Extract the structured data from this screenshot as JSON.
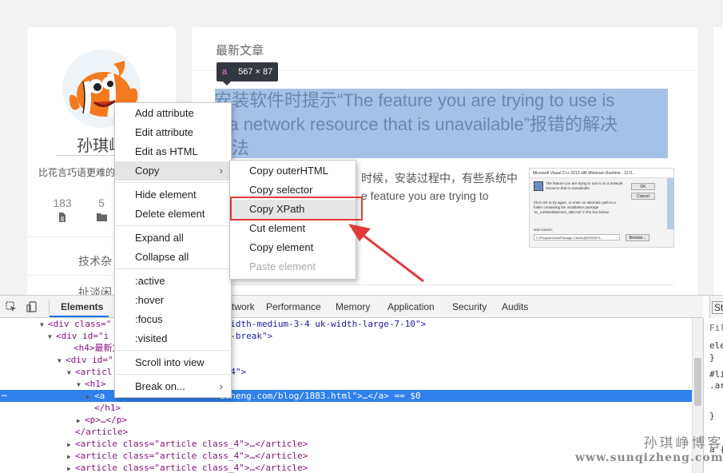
{
  "profile": {
    "name": "孙琪峥",
    "name_visible": "孙琪屾",
    "motto": "比花言巧语更难的",
    "stats": [
      {
        "value": "183",
        "icon": "document-icon"
      },
      {
        "value": "5",
        "icon": "folder-icon"
      }
    ],
    "link1": "技术杂",
    "link2": "扯淡闲"
  },
  "main": {
    "section_title": "最新文章",
    "article_title": "安装软件时提示“The feature you are trying to use is on a network resource that is unavailable”报错的解决办法",
    "article_title_visible": "安装软件时提示“The feature you are trying to use is\nn a network resource that is unavailable”报错的解决\n方法",
    "excerpt_line1": "时候，安装过程中，有些系统中",
    "excerpt_line2": "e feature you are trying to",
    "thumb": {
      "window_title": "Microsoft Visual C++ 2013 x86 Minimum Runtime - 12.0...",
      "message": "The feature you are trying to use is on a network resource that is unavailable.",
      "hint": "Click OK to try again, or enter an alternate path to a folder containing the installation package 'vc_runtimeMinimum_x86.msi' in the box below.",
      "source_label": "Use source:",
      "path": "C:\\ProgramData\\Package Cache\\{B8F0B3F8-...",
      "ok": "OK",
      "cancel": "Cancel",
      "browse": "Browse..."
    }
  },
  "inspect_tooltip": {
    "tag": "a",
    "size": "567 × 87"
  },
  "devtools": {
    "tabs": [
      "Elements",
      "twork",
      "Performance",
      "Memory",
      "Application",
      "Security",
      "Audits"
    ],
    "active_tab": "Elements",
    "dom_lines": [
      {
        "indent": 50,
        "toggle": "▼",
        "html": "<div class=\"",
        "rest": "-width-medium-3-4 uk-width-large-7-10\">"
      },
      {
        "indent": 60,
        "toggle": "▼",
        "html": "<div id=\"i",
        "rest": "xt-break\">"
      },
      {
        "indent": 82,
        "toggle": "",
        "html": "<h4>最新文",
        "rest": ""
      },
      {
        "indent": 72,
        "toggle": "▼",
        "html": "<div id=\"",
        "rest": ""
      },
      {
        "indent": 84,
        "toggle": "▼",
        "html": "<articl",
        "rest": "s_4\">"
      },
      {
        "indent": 96,
        "toggle": "▼",
        "html": "<h1>",
        "rest": ""
      },
      {
        "indent": 108,
        "toggle": "▶",
        "html": "<a ",
        "rest": "izheng.com/blog/1883.html\">…</a> == $0"
      },
      {
        "indent": 108,
        "toggle": "",
        "html": "</h1>",
        "rest": ""
      },
      {
        "indent": 96,
        "toggle": "▶",
        "html": "<p>…</p>",
        "rest": ""
      },
      {
        "indent": 84,
        "toggle": "",
        "html": "</article>",
        "rest": ""
      },
      {
        "indent": 84,
        "toggle": "▶",
        "html": "<article class=\"article class_4\">…</article>",
        "rest": ""
      },
      {
        "indent": 84,
        "toggle": "▶",
        "html": "<article class=\"article class_4\">…</article>",
        "rest": ""
      },
      {
        "indent": 84,
        "toggle": "▶",
        "html": "<article class=\"article class_4\">…</article>",
        "rest": ""
      }
    ],
    "selected_index": 6,
    "row_dots": "…",
    "styles_tab": "Sty",
    "styles_lines": [
      "Filte",
      "ele",
      "}",
      "#li",
      ".ar",
      "}",
      "a {"
    ]
  },
  "context_menu": {
    "items": [
      {
        "label": "Add attribute",
        "sep_before": false
      },
      {
        "label": "Edit attribute",
        "sep_before": false
      },
      {
        "label": "Edit as HTML",
        "sep_before": false
      },
      {
        "label": "Copy",
        "sep_before": false,
        "submenu": true,
        "highlighted": true
      },
      {
        "label": "Hide element",
        "sep_before": true
      },
      {
        "label": "Delete element",
        "sep_before": false
      },
      {
        "label": "Expand all",
        "sep_before": true
      },
      {
        "label": "Collapse all",
        "sep_before": false
      },
      {
        "label": ":active",
        "sep_before": true
      },
      {
        "label": ":hover",
        "sep_before": false
      },
      {
        "label": ":focus",
        "sep_before": false
      },
      {
        "label": ":visited",
        "sep_before": false
      },
      {
        "label": "Scroll into view",
        "sep_before": true
      },
      {
        "label": "Break on...",
        "sep_before": true,
        "submenu": true
      }
    ]
  },
  "copy_submenu": {
    "items": [
      {
        "label": "Copy outerHTML"
      },
      {
        "label": "Copy selector"
      },
      {
        "label": "Copy XPath",
        "highlighted": true
      },
      {
        "label": "Cut element"
      },
      {
        "label": "Copy element"
      },
      {
        "label": "Paste element",
        "disabled": true
      }
    ]
  },
  "watermark": {
    "line1": "孙琪峥博客",
    "line2": "www.sunqizheng.com"
  },
  "colors": {
    "selection": "#a5c2e6",
    "dom_selected": "#2f80ed",
    "annotation_red": "#e03a3a",
    "tab_underline": "#1a73e8"
  }
}
